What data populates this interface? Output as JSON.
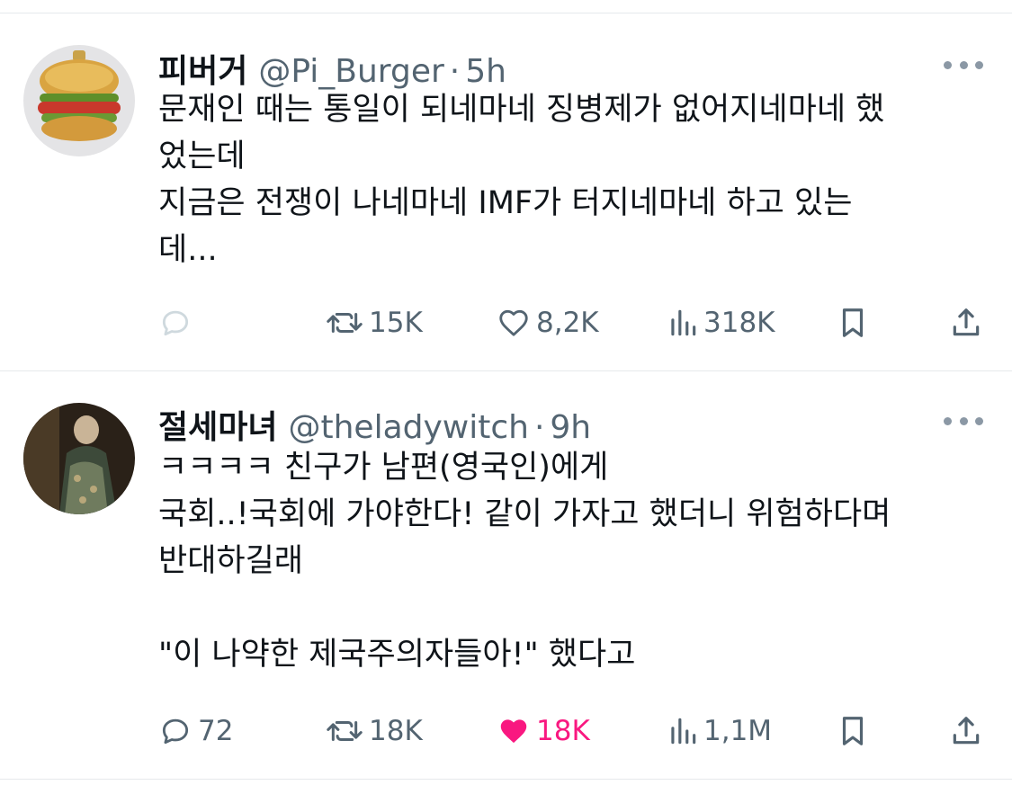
{
  "tweets": [
    {
      "display_name": "피버거",
      "handle": "@Pi_Burger",
      "separator": "·",
      "time": "5h",
      "text": "문재인 때는 통일이 되네마네 징병제가 없어지네마네 했\n었는데\n지금은 전쟁이 나네마네 IMF가 터지네마네 하고 있는\n데...",
      "avatar_icon": "burger-ornament-avatar",
      "replies": "",
      "retweets": "15K",
      "likes": "8,2K",
      "views": "318K",
      "liked": false
    },
    {
      "display_name": "절세마녀",
      "handle": "@theladywitch",
      "separator": "·",
      "time": "9h",
      "text": "ㅋㅋㅋㅋ 친구가 남편(영국인)에게\n국회..!국회에 가야한다! 같이 가자고 했더니 위험하다며\n반대하길래\n\n\"이 나약한 제국주의자들아!\" 했다고",
      "avatar_icon": "portrait-painting-avatar",
      "replies": "72",
      "retweets": "18K",
      "likes": "18K",
      "views": "1,1M",
      "liked": true
    }
  ],
  "icons": {
    "reply": "reply-icon",
    "retweet": "retweet-icon",
    "like": "heart-icon",
    "views": "views-icon",
    "bookmark": "bookmark-icon",
    "share": "share-icon",
    "more": "more-icon"
  },
  "colors": {
    "text": "#0f1419",
    "secondary": "#536471",
    "like_active": "#f91880",
    "divider": "#e6e9ec"
  }
}
